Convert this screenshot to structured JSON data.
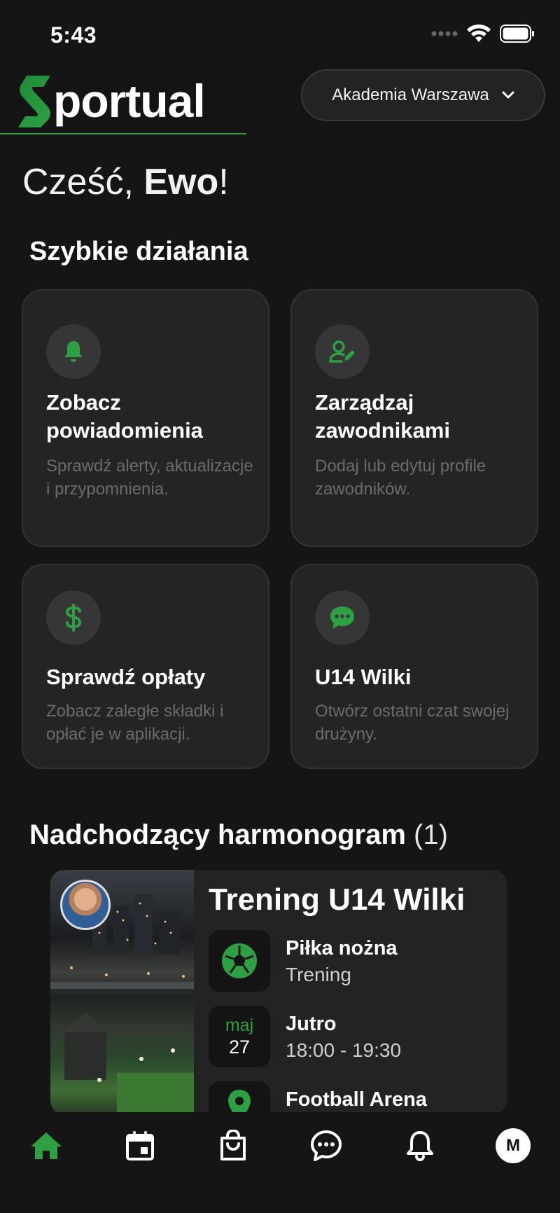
{
  "status_bar": {
    "time": "5:43"
  },
  "header": {
    "logo_text": "portual",
    "academy_selector": {
      "label": "Akademia Warszawa"
    }
  },
  "greeting": {
    "prefix": "Cześć, ",
    "name": "Ewo",
    "suffix": "!"
  },
  "quick_actions": {
    "title": "Szybkie działania",
    "items": [
      {
        "title": "Zobacz powiadomienia",
        "description": "Sprawdź alerty, aktualizacje i przypomnienia.",
        "icon": "bell-icon"
      },
      {
        "title": "Zarządzaj zawodnikami",
        "description": "Dodaj lub edytuj profile zawodników.",
        "icon": "user-edit-icon"
      },
      {
        "title": "Sprawdź opłaty",
        "description": "Zobacz zaległe składki i opłać je w aplikacji.",
        "icon": "dollar-icon"
      },
      {
        "title": "U14 Wilki",
        "description": "Otwórz ostatni czat swojej drużyny.",
        "icon": "chat-icon"
      }
    ]
  },
  "schedule": {
    "title": "Nadchodzący harmonogram",
    "count": "(1)",
    "event": {
      "title": "Trening U14 Wilki",
      "sport": "Piłka nożna",
      "type": "Trening",
      "date_month": "maj",
      "date_day": "27",
      "day_label": "Jutro",
      "time": "18:00 - 19:30",
      "location": "Football Arena"
    }
  },
  "bottom_nav": {
    "items": [
      "home-icon",
      "calendar-icon",
      "shop-bag-icon",
      "chat-icon",
      "bell-icon",
      "profile-avatar"
    ],
    "avatar_initial": "M",
    "active_color": "#2ea043"
  },
  "colors": {
    "accent": "#2ea043",
    "background": "#151515",
    "card": "#242424"
  }
}
